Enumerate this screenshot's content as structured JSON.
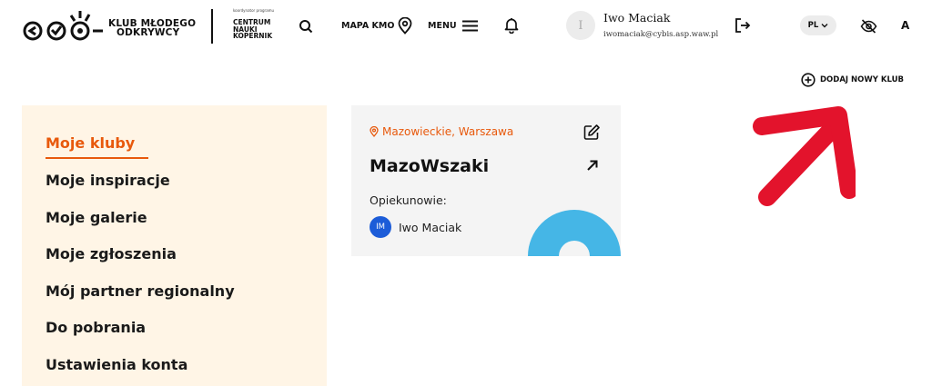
{
  "header": {
    "logo_line1": "KLUB MŁODEGO",
    "logo_line2": "ODKRYWCY",
    "cnk_caption": "koordynator programu",
    "cnk_line1": "CENTRUM",
    "cnk_line2": "NAUKI",
    "cnk_line3": "KOPERNIK",
    "map_label": "MAPA KMO",
    "menu_label": "MENU",
    "user": {
      "avatar_letter": "I",
      "name": "Iwo Maciak",
      "email": "iwomaciak@cybis.asp.waw.pl"
    },
    "language": "PL",
    "font_size_label": "A"
  },
  "actions": {
    "add_club_label": "DODAJ NOWY KLUB"
  },
  "sidebar": {
    "items": [
      {
        "label": "Moje kluby",
        "active": true
      },
      {
        "label": "Moje inspiracje",
        "active": false
      },
      {
        "label": "Moje galerie",
        "active": false
      },
      {
        "label": "Moje zgłoszenia",
        "active": false
      },
      {
        "label": "Mój partner regionalny",
        "active": false
      },
      {
        "label": "Do pobrania",
        "active": false
      },
      {
        "label": "Ustawienia konta",
        "active": false
      }
    ]
  },
  "club_card": {
    "location": "Mazowieckie, Warszawa",
    "name": "MazoWszaki",
    "guardians_label": "Opiekunowie:",
    "guardians": [
      {
        "initials": "IM",
        "name": "Iwo Maciak"
      }
    ]
  },
  "colors": {
    "accent": "#e8590c",
    "sidebar_bg": "#fff5e6",
    "card_bg": "#f4f4f4",
    "avatar_blue": "#1c5cd8",
    "deco_blue": "#45b6e6",
    "annotation_red": "#e3132c"
  },
  "icons": {
    "logo": "kmo-logo-icon",
    "search": "search-icon",
    "map": "map-pin-icon",
    "menu": "hamburger-icon",
    "notifications": "bell-icon",
    "logout": "logout-icon",
    "language": "chevron-down-icon",
    "accessibility": "eye-off-icon",
    "add": "plus-circle-icon",
    "edit": "edit-icon",
    "open": "arrow-up-right-icon",
    "annotation": "red-arrow-icon"
  }
}
